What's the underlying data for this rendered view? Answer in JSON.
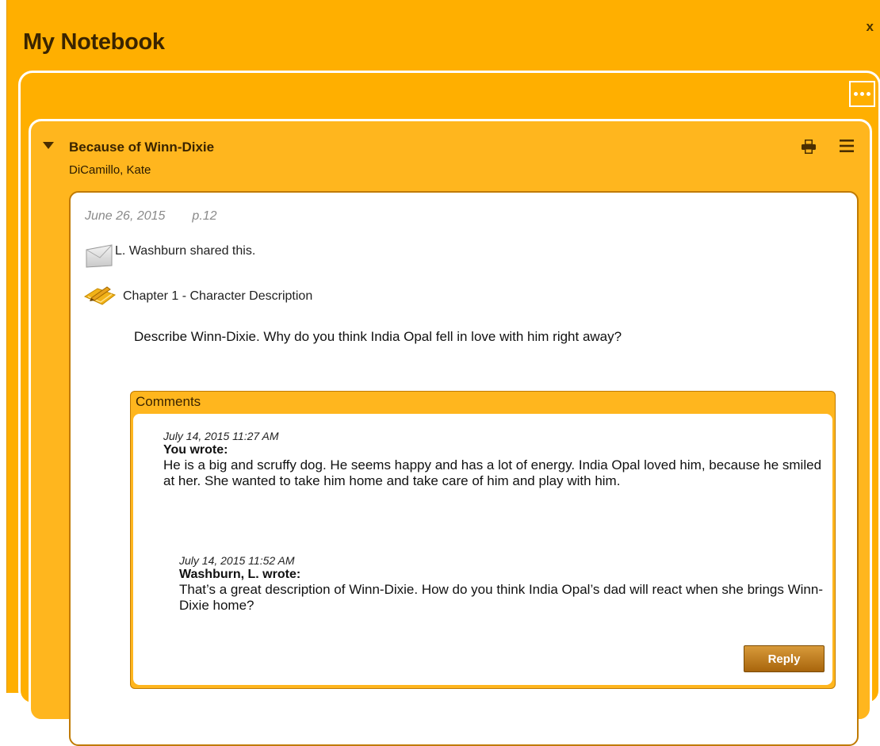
{
  "window": {
    "title": "My Notebook",
    "close_label": "x"
  },
  "book": {
    "title": "Because of Winn-Dixie",
    "author": "DiCamillo, Kate"
  },
  "note": {
    "date": "June 26, 2015",
    "page": "p.12",
    "shared_by": "L. Washburn shared this.",
    "chapter_title": "Chapter 1 - Character Description",
    "prompt": "Describe Winn-Dixie. Why do you think India Opal fell in love with him right away?"
  },
  "comments": {
    "header": "Comments",
    "items": [
      {
        "timestamp": "July 14, 2015 11:27 AM",
        "author": "You wrote:",
        "text": "He is a big and scruffy dog. He seems happy and has a lot of energy. India Opal loved him, because he smiled at her. She wanted to take him home and take care of him and play with him."
      },
      {
        "timestamp": "July 14, 2015 11:52 AM",
        "author": "Washburn, L. wrote:",
        "text": "That’s a great description of Winn-Dixie. How do you think India Opal’s dad will react when she brings Winn-Dixie home?"
      }
    ],
    "reply_label": "Reply"
  },
  "colors": {
    "background": "#ffaf00",
    "panel_border": "#ffffff",
    "reply_button": "#b8730f"
  },
  "icons": [
    "close-icon",
    "more-options-icon",
    "collapse-triangle-icon",
    "print-icon",
    "menu-icon",
    "envelope-icon",
    "pencil-note-icon"
  ]
}
